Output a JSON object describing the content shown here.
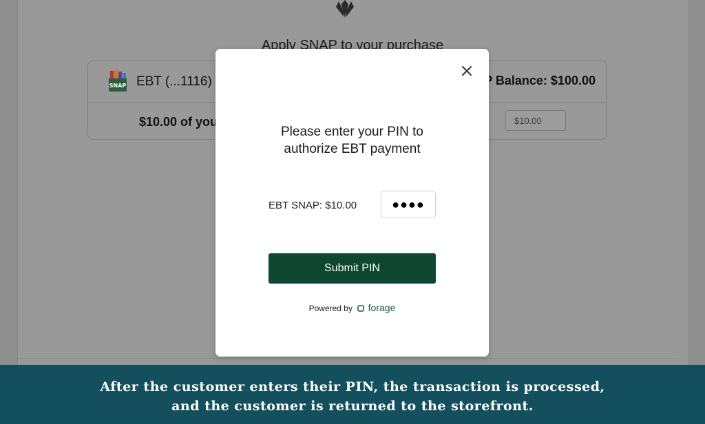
{
  "background": {
    "apply_title": "Apply SNAP to your purchase",
    "card": {
      "ebt_label": "EBT (...1116)",
      "balance": "SNAP Balance: $100.00",
      "amount_text": "$10.00 of your",
      "amount_input_value": "$10.00"
    }
  },
  "modal": {
    "title_line1": "Please enter your PIN to",
    "title_line2": "authorize EBT payment",
    "pin_label": "EBT SNAP: $10.00",
    "pin_value": "●●●●",
    "submit_label": "Submit PIN",
    "powered_by": "Powered by",
    "brand": "forage"
  },
  "caption": {
    "line1": "After the customer enters their PIN, the transaction is processed,",
    "line2": "and the customer is returned to the storefront."
  },
  "icons": {
    "close": "close-icon",
    "snap_logo": "snap-logo-icon",
    "store_logo": "store-logo-icon",
    "forage_logo": "forage-logo-icon"
  },
  "colors": {
    "submit_button": "#0e4730",
    "caption_bg": "#134f5c",
    "overlay": "#999999"
  }
}
